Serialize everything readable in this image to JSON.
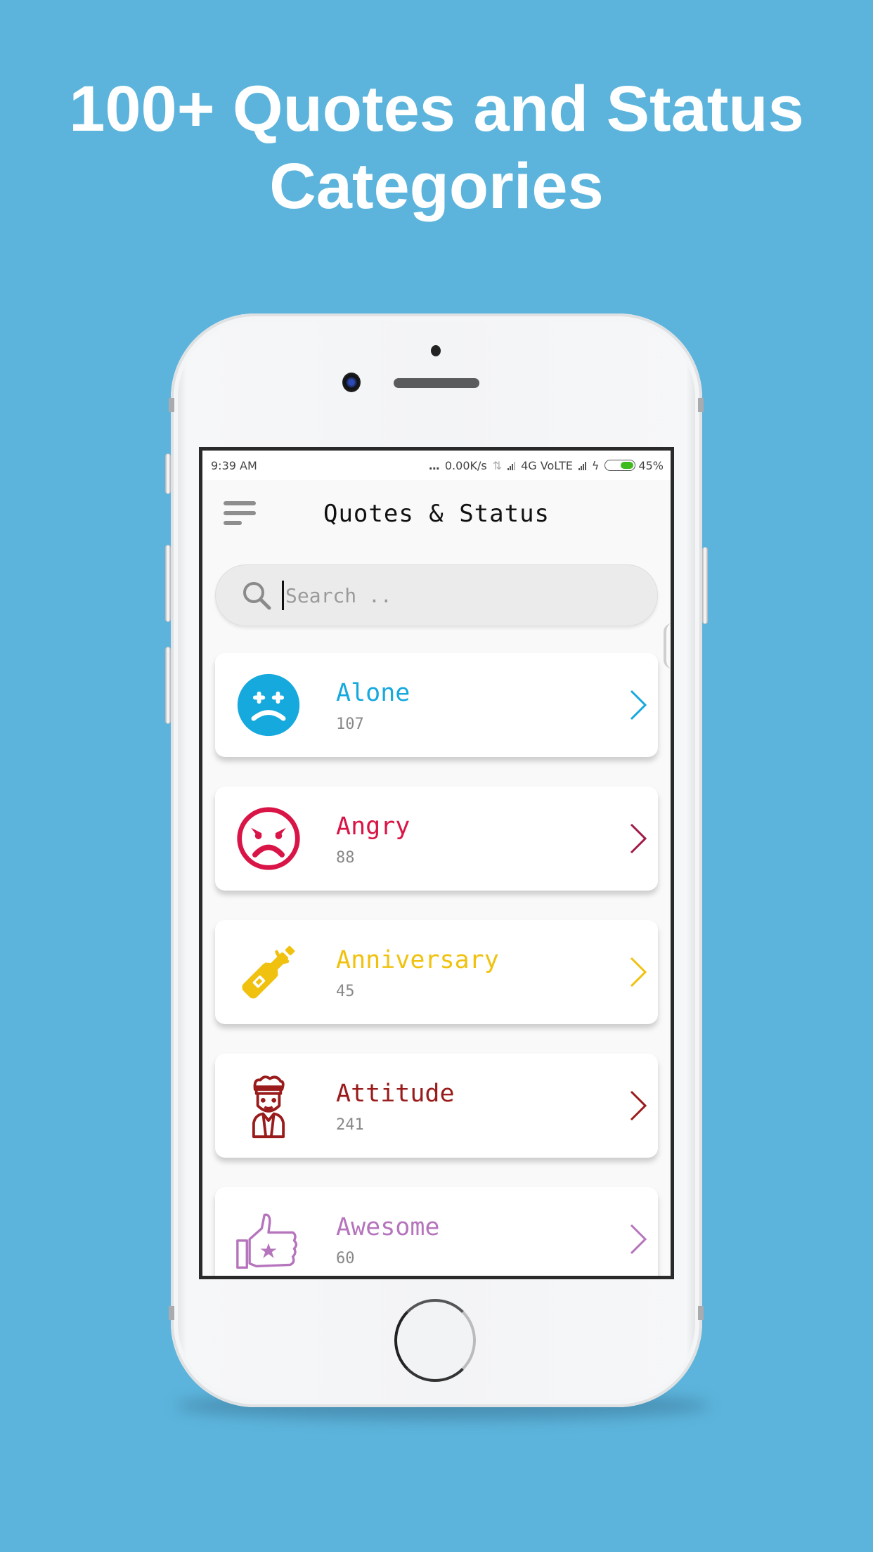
{
  "headline": {
    "line1": "100+ Quotes and Status",
    "line2": "Categories"
  },
  "status_bar": {
    "time": "9:39 AM",
    "dots": "...",
    "speed": "0.00K/s",
    "network": "4G VoLTE",
    "battery_percent": "45%",
    "battery_level": 0.45
  },
  "app": {
    "title": "Quotes & Status",
    "menu_icon": "hamburger-menu-icon"
  },
  "search": {
    "placeholder": "Search ..",
    "value": "",
    "icon": "search-icon"
  },
  "categories": [
    {
      "name": "Alone",
      "count": "107",
      "color": "#16a9de",
      "icon": "sad-face-icon"
    },
    {
      "name": "Angry",
      "count": "88",
      "color": "#d91447",
      "icon": "angry-face-icon"
    },
    {
      "name": "Anniversary",
      "count": "45",
      "color": "#f0c20f",
      "icon": "champagne-bottle-icon"
    },
    {
      "name": "Attitude",
      "count": "241",
      "color": "#9a1b1b",
      "icon": "attitude-person-icon"
    },
    {
      "name": "Awesome",
      "count": "60",
      "color": "#b574bc",
      "icon": "thumbs-up-star-icon"
    }
  ],
  "colors": {
    "background": "#5cb4dc",
    "headline_text": "#ffffff"
  }
}
